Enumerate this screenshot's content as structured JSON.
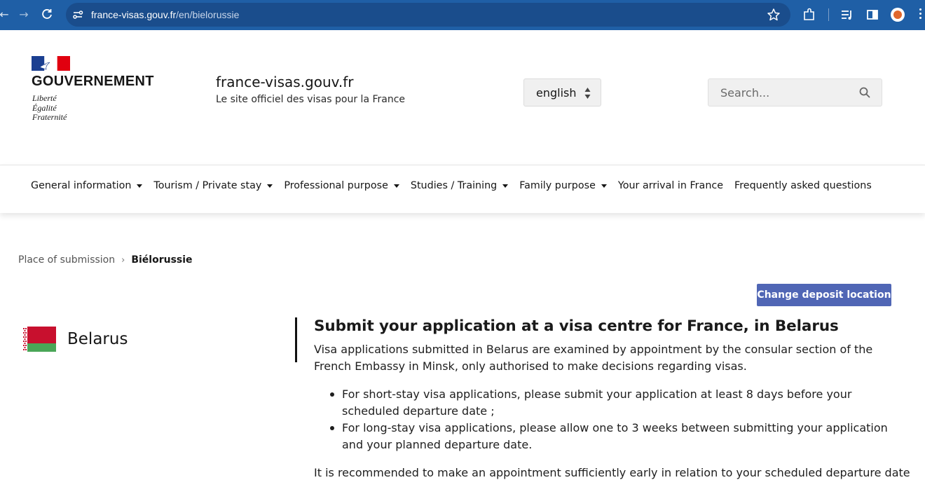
{
  "browser": {
    "url_host": "france-visas.gouv.fr",
    "url_path": "/en/bielorussie"
  },
  "header": {
    "gov_title": "GOUVERNEMENT",
    "motto": [
      "Liberté",
      "Égalité",
      "Fraternité"
    ],
    "site_name": "france-visas.gouv.fr",
    "site_tagline": "Le site officiel des visas pour la France",
    "language": "english",
    "search_placeholder": "Search..."
  },
  "nav": {
    "items": [
      {
        "label": "General information",
        "dropdown": true
      },
      {
        "label": "Tourism / Private stay",
        "dropdown": true
      },
      {
        "label": "Professional purpose",
        "dropdown": true
      },
      {
        "label": "Studies / Training",
        "dropdown": true
      },
      {
        "label": "Family purpose",
        "dropdown": true
      },
      {
        "label": "Your arrival in France",
        "dropdown": false
      },
      {
        "label": "Frequently asked questions",
        "dropdown": false
      }
    ]
  },
  "breadcrumb": {
    "parent": "Place of submission",
    "separator": "›",
    "current": "Biélorussie"
  },
  "actions": {
    "change_deposit": "Change deposit location"
  },
  "country": {
    "name": "Belarus"
  },
  "article": {
    "title": "Submit your application at a visa centre for France, in Belarus",
    "intro": "Visa applications submitted in Belarus are examined by appointment by the consular section of the French Embassy in Minsk, only authorised to make decisions regarding visas.",
    "bullets": [
      "For short-stay visa applications, please submit your application at least 8 days before your scheduled departure date ;",
      "For long-stay visa applications, please allow one to 3 weeks between submitting your application and your planned departure date."
    ],
    "recommendation": "It is recommended to make an appointment sufficiently early in relation to your scheduled departure date"
  },
  "colors": {
    "browser_bar": "#1f5fa6",
    "primary_button": "#5066b5",
    "flag_red": "#c8102e",
    "flag_green": "#4aa657"
  }
}
